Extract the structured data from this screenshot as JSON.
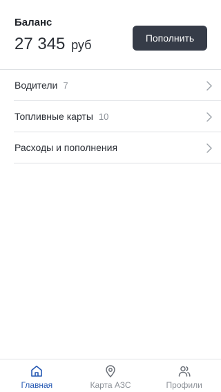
{
  "balance": {
    "label": "Баланс",
    "amount": "27 345",
    "currency": "руб",
    "topup_label": "Пополнить"
  },
  "menu": [
    {
      "label": "Водители",
      "count": "7",
      "icon": "chevron-right-icon"
    },
    {
      "label": "Топливные карты",
      "count": "10",
      "icon": "chevron-right-icon"
    },
    {
      "label": "Расходы и пополнения",
      "count": "",
      "icon": "chevron-right-icon"
    }
  ],
  "tabs": [
    {
      "label": "Главная",
      "icon": "home-icon",
      "active": true
    },
    {
      "label": "Карта АЗС",
      "icon": "map-pin-icon",
      "active": false
    },
    {
      "label": "Профили",
      "icon": "users-icon",
      "active": false
    }
  ],
  "colors": {
    "accent": "#2659b3",
    "button_bg": "#363c48",
    "inactive": "#8c9198",
    "divider": "#dcdfe3"
  }
}
